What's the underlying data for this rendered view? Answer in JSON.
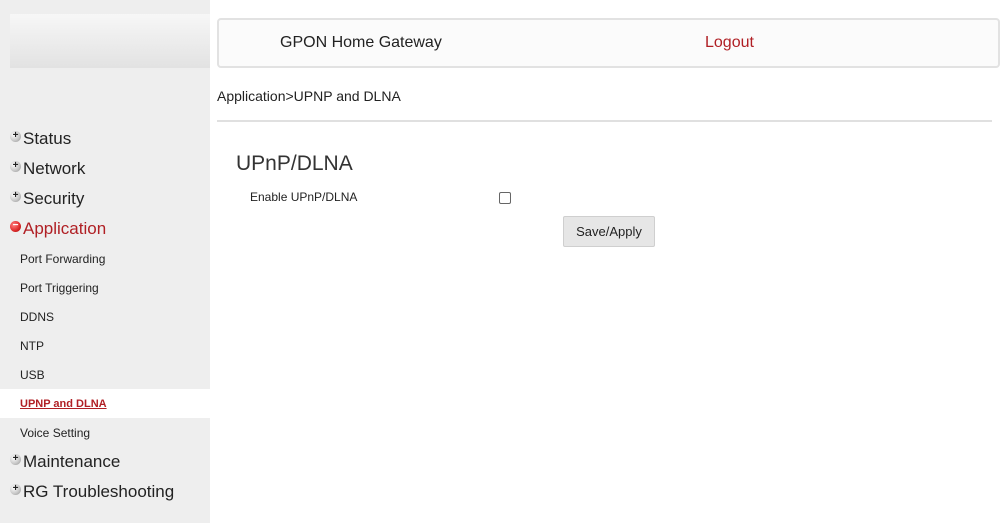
{
  "header": {
    "title": "GPON Home Gateway",
    "logout_label": "Logout"
  },
  "breadcrumb": "Application>UPNP and DLNA",
  "menu": {
    "status": "Status",
    "network": "Network",
    "security": "Security",
    "application": "Application",
    "application_items": [
      "Port Forwarding",
      "Port Triggering",
      "DDNS",
      "NTP",
      "USB",
      "UPNP and DLNA",
      "Voice Setting"
    ],
    "maintenance": "Maintenance",
    "rg_troubleshooting": "RG Troubleshooting"
  },
  "main": {
    "title": "UPnP/DLNA",
    "enable_label": "Enable UPnP/DLNA",
    "enable_checked": false,
    "save_label": "Save/Apply"
  },
  "colors": {
    "accent_red": "#b01f24",
    "sidebar_bg": "#eeeeee"
  },
  "icons": {
    "collapsed": "plus-bullet-icon",
    "expanded": "minus-bullet-icon"
  }
}
